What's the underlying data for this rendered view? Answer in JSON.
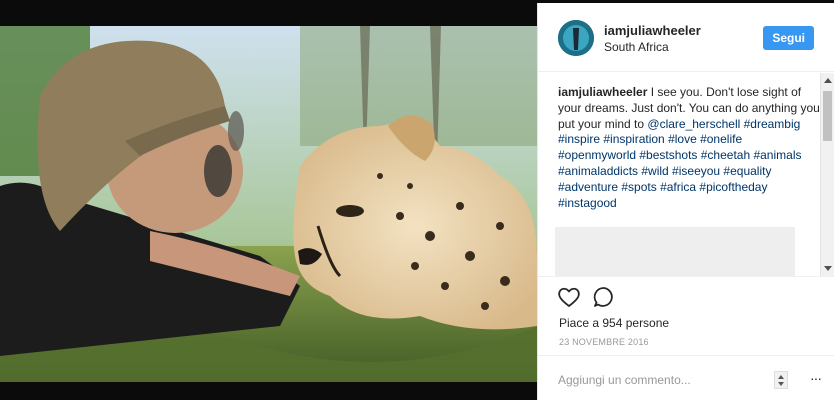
{
  "post": {
    "username": "iamjuliawheeler",
    "location": "South Africa",
    "follow_label": "Segui",
    "caption": {
      "user": "iamjuliawheeler",
      "text": " I see you. Don't lose sight of your dreams. Just don't. You can do anything you put your mind to ",
      "mention": "@clare_herschell",
      "tags_line": " #dreambig #inspire #inspiration #love #onelife #openmyworld #bestshots #cheetah #animals #animaladdicts #wild #iseeyou #equality #adventure #spots #africa #picoftheday #instagood"
    },
    "likes": "Piace a 954 persone",
    "date": "23 NOVEMBRE 2016",
    "comment_placeholder": "Aggiungi un commento...",
    "more_label": "···"
  },
  "icons": {
    "like": "heart-icon",
    "comment": "comment-icon",
    "more": "more-icon"
  },
  "colors": {
    "follow_button": "#3897f0",
    "hashtag": "#003569",
    "text": "#262626",
    "muted": "#999999"
  }
}
